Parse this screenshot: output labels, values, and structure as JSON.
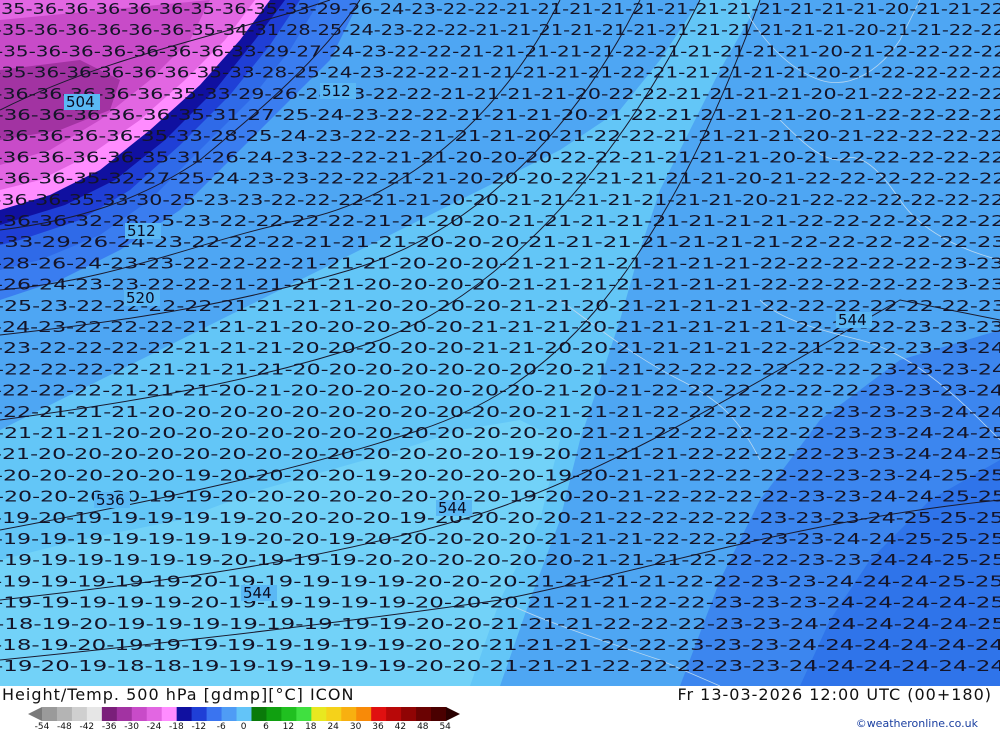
{
  "map": {
    "temperature_labels": [
      {
        "row": 0,
        "text": "-35-36-36-36-36-36-35-36-35-33-29-26-24-23-22-22-21-21-21-21-21-21-21-21-21-21-21-21-20-21-21-22"
      },
      {
        "row": 1,
        "text": "-35-36-36-36-36-36-35-34-31-28-25-24-23-22-22-21-21-21-21-21-21-21-21-21-21-21-21-20-21-21-22-22"
      },
      {
        "row": 2,
        "text": "-35-36-36-36-36-36-36-33-29-27-24-23-22-22-21-21-21-21-21-22-21-21-21-21-21-20-21-22-22-22-22"
      },
      {
        "row": 3,
        "text": "-35-36-36-36-36-36-35-33-28-25-24-23-22-22-21-21-21-21-21-22-21-21-21-21-21-20-21-22-22-22-22"
      },
      {
        "row": 4,
        "text": "-36-36-36-36-36-35-33-29-26-24-23-22-22-21-21-21-21-20-22-22-21-21-21-21-20-21-22-22-22-22"
      },
      {
        "row": 5,
        "text": "-36-36-36-36-36-35-31-27-25-24-23-22-22-21-21-21-20-21-22-21-21-21-21-20-21-22-22-22-22"
      },
      {
        "row": 6,
        "text": "-36-36-36-36-35-33-28-25-24-23-22-22-21-21-21-20-21-22-22-21-21-21-21-20-21-22-22-22-22"
      },
      {
        "row": 7,
        "text": "-36-36-36-36-35-31-26-24-23-22-22-21-21-20-20-20-22-22-21-21-21-21-20-21-22-22-22-22-22"
      },
      {
        "row": 8,
        "text": "-36-36-35-32-27-25-24-23-23-22-22-21-21-20-20-20-22-21-21-21-21-20-21-22-22-22-22-22-22"
      },
      {
        "row": 9,
        "text": "-36-36-35-33-30-25-23-23-22-22-22-21-21-20-20-21-21-21-21-21-21-21-20-21-22-22-22-22-22-22"
      },
      {
        "row": 10,
        "text": "-36-36-32-28-25-23-22-22-22-22-21-21-20-20-21-21-21-21-21-21-21-21-22-22-22-22-22-22"
      },
      {
        "row": 11,
        "text": "-33-29-26-24-23-22-22-22-21-21-21-20-20-20-21-21-21-21-21-21-21-22-22-22-22-22-23"
      },
      {
        "row": 12,
        "text": "-28-26-24-23-23-22-22-22-21-21-21-20-20-20-21-21-21-21-21-21-21-22-22-22-22-22-23-23"
      },
      {
        "row": 13,
        "text": "-26-24-23-23-22-22-21-21-21-21-20-20-20-20-21-21-21-21-21-21-21-22-22-22-22-22-23-23"
      },
      {
        "row": 14,
        "text": "-25-23-22-22-22-22-21-21-21-21-20-20-20-20-21-21-20-21-21-21-21-22-22-22-22-22-22-23"
      },
      {
        "row": 15,
        "text": "-24-23-22-22-22-21-21-21-20-20-20-20-20-21-21-21-20-21-21-21-21-21-22-22-22-23-23-23"
      },
      {
        "row": 16,
        "text": "-23-22-22-22-22-21-21-21-20-20-20-20-20-21-21-20-20-21-21-21-21-22-21-22-22-23-23-24"
      },
      {
        "row": 17,
        "text": "-22-22-22-22-21-21-21-21-20-20-20-20-20-20-20-20-21-21-22-22-22-22-22-22-23-23-23-24"
      },
      {
        "row": 18,
        "text": "-22-22-22-21-21-21-20-21-20-20-20-20-20-20-20-21-20-21-22-22-22-22-22-22-23-23-23-24"
      },
      {
        "row": 19,
        "text": "-22-21-21-21-20-20-20-20-20-20-20-20-20-20-20-21-21-21-22-22-22-22-22-23-23-23-24-24"
      },
      {
        "row": 20,
        "text": "-21-21-21-20-20-20-20-20-20-20-20-20-20-20-20-20-21-21-22-22-22-22-22-23-23-24-24-25"
      },
      {
        "row": 21,
        "text": "-21-20-20-20-20-20-20-20-20-20-20-20-20-20-19-20-21-21-21-22-22-22-22-23-23-24-24-25"
      },
      {
        "row": 22,
        "text": "-20-20-20-20-20-19-20-20-20-20-19-20-20-20-20-19-20-21-21-22-22-22-22-23-23-24-25-25"
      },
      {
        "row": 23,
        "text": "-20-20-20-20-19-19-20-20-20-20-20-20-20-20-19-20-20-21-22-22-22-22-23-23-24-24-25-25"
      },
      {
        "row": 24,
        "text": "-19-20-19-19-19-19-19-20-20-20-20-19-20-20-20-20-21-22-22-22-22-23-23-23-24-25-25-25"
      },
      {
        "row": 25,
        "text": "-19-19-19-19-19-19-19-20-20-19-20-20-20-20-20-21-21-21-22-22-22-23-23-24-24-25-25-25"
      },
      {
        "row": 26,
        "text": "-19-19-19-19-19-19-20-19-19-19-20-20-20-20-20-20-21-21-21-22-22-22-23-23-24-24-25-25"
      },
      {
        "row": 27,
        "text": "-19-19-19-19-19-20-19-19-19-19-19-20-20-20-21-21-21-21-22-22-23-23-24-24-24-25-25"
      },
      {
        "row": 28,
        "text": "-19-19-19-19-19-20-19-19-19-19-19-20-20-20-21-21-21-22-22-23-23-23-24-24-24-24-25"
      },
      {
        "row": 29,
        "text": "-18-19-20-19-19-19-19-19-19-19-19-20-20-21-21-21-22-22-22-23-23-24-24-24-24-24-25"
      },
      {
        "row": 30,
        "text": "-18-19-20-19-19-19-19-19-19-19-19-20-20-21-21-21-22-22-23-23-23-24-24-24-24-24-24"
      },
      {
        "row": 31,
        "text": "-19-20-19-18-18-19-19-19-19-19-19-20-20-21-21-21-22-22-22-23-23-24-24-24-24-24-24"
      }
    ],
    "height_labels": [
      {
        "id": "h1",
        "text": "504"
      },
      {
        "id": "h2",
        "text": "512"
      },
      {
        "id": "h3",
        "text": "512"
      },
      {
        "id": "h4",
        "text": "520"
      },
      {
        "id": "h5",
        "text": "536"
      },
      {
        "id": "h6",
        "text": "544"
      },
      {
        "id": "h7",
        "text": "544"
      },
      {
        "id": "h8",
        "text": "544"
      }
    ]
  },
  "footer": {
    "title": "Height/Temp. 500 hPa [gdmp][°C] ICON",
    "datetime": "Fr 13-03-2026 12:00 UTC (00+180)",
    "credit": "©weatheronline.co.uk",
    "colorbar": {
      "ticks": [
        "-54",
        "-48",
        "-42",
        "-36",
        "-30",
        "-24",
        "-18",
        "-12",
        "-6",
        "0",
        "6",
        "12",
        "18",
        "24",
        "30",
        "36",
        "42",
        "48",
        "54"
      ],
      "colors": [
        "#9a9a9a",
        "#b4b4b4",
        "#cfcfcf",
        "#e6e6e6",
        "#7a1f7a",
        "#a233a2",
        "#c84bc8",
        "#e266e2",
        "#ff8cff",
        "#1010a0",
        "#1f3fd6",
        "#3a74f0",
        "#4f9cf5",
        "#63c4f8",
        "#0a7a0a",
        "#10a010",
        "#20c020",
        "#40e040",
        "#e8e820",
        "#f5d21a",
        "#f8b010",
        "#f88a08",
        "#e01010",
        "#b80808",
        "#900404",
        "#6a0202",
        "#4a0000"
      ]
    }
  }
}
